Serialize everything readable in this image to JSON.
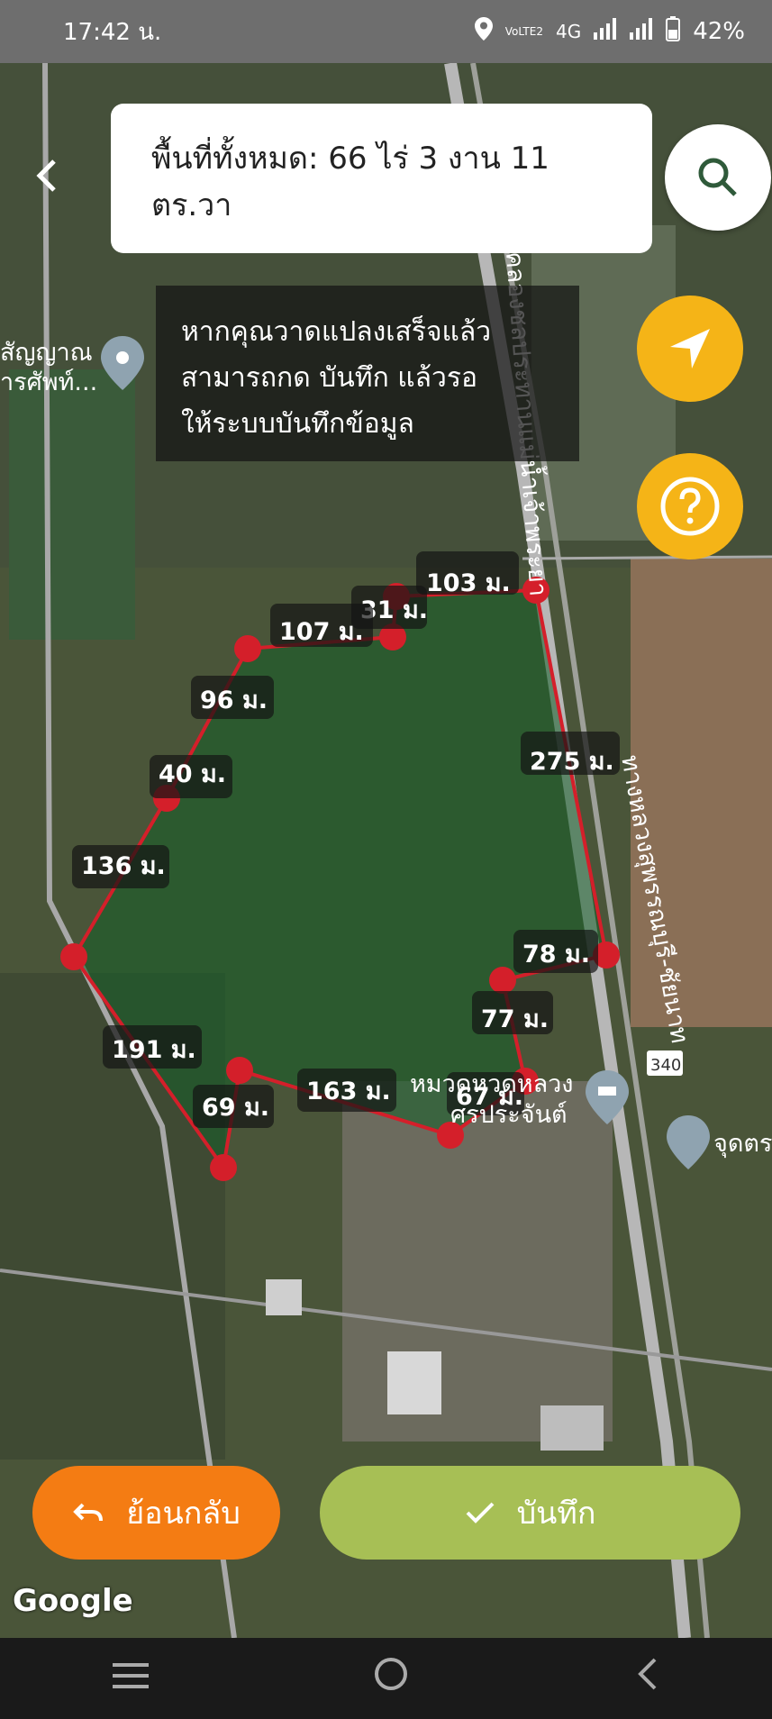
{
  "status": {
    "time": "17:42 น.",
    "network": "4G",
    "lte": "VoLTE2",
    "battery": "42%"
  },
  "area_summary": {
    "line1": "พื้นที่ทั้งหมด: 66 ไร่ 3 งาน 11",
    "line2": "ตร.วา"
  },
  "hint": {
    "line1": "หากคุณวาดแปลงเสร็จแล้ว",
    "line2": "สามารถกด บันทึก แล้วรอ",
    "line3": "ให้ระบบบันทึกข้อมูล"
  },
  "distances": {
    "d1": "103 ม.",
    "d2": "31 ม.",
    "d3": "107 ม.",
    "d4": "96 ม.",
    "d5": "40 ม.",
    "d6": "136 ม.",
    "d7": "275 ม.",
    "d8": "78 ม.",
    "d9": "77 ม.",
    "d10": "67 ม.",
    "d11": "163 ม.",
    "d12": "69 ม.",
    "d13": "191 ม."
  },
  "map_labels": {
    "poi_left_line1": "สัญญาณ",
    "poi_left_line2": "ารศัพท์...",
    "poi_temple_line1": "หมวดหวดหลวง",
    "poi_temple_line2": "ศรประจันต์",
    "poi_right": "จุดตร",
    "road_number": "340",
    "road_name_top": "คลองชลประทานแม่น้ำเจ้าพระยา",
    "road_name_right": "ทางหลวงสุพรรณบุรี-ชัยนาท"
  },
  "buttons": {
    "undo_label": "ย้อนกลับ",
    "save_label": "บันทึก"
  },
  "attribution": "Google",
  "colors": {
    "accent_orange": "#f47c13",
    "accent_green": "#a7bf55",
    "marker_yellow": "#f5b417",
    "polygon_red": "#d41f2a"
  },
  "icons": {
    "back": "chevron-left-icon",
    "search": "search-icon",
    "locate": "navigation-arrow-icon",
    "help": "question-icon",
    "undo": "undo-icon",
    "save": "check-icon"
  }
}
